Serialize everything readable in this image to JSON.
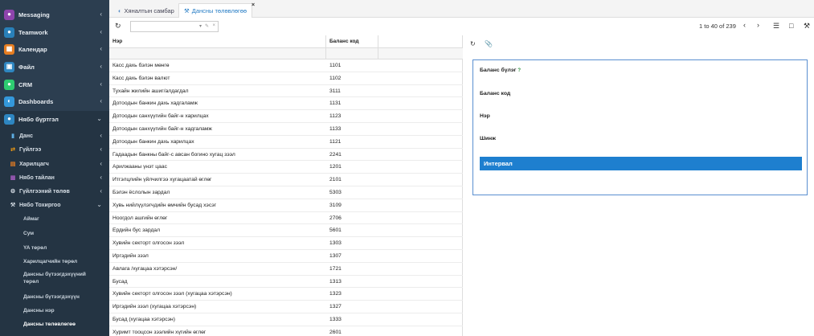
{
  "tabs": [
    {
      "label": "Хяналтын самбар",
      "icon": "dashboard-icon"
    },
    {
      "label": "Дансны төлөвлөгөө",
      "icon": "wrench-icon"
    }
  ],
  "sidebar": {
    "modules": [
      {
        "label": "Messaging",
        "icon": "people-icon",
        "color": "#8e44ad"
      },
      {
        "label": "Teamwork",
        "icon": "user-icon",
        "color": "#2980b9"
      },
      {
        "label": "Календар",
        "icon": "calendar-icon",
        "color": "#e67e22"
      },
      {
        "label": "Файл",
        "icon": "archive-icon",
        "color": "#2e86c1"
      },
      {
        "label": "CRM",
        "icon": "chat-icon",
        "color": "#2ecc71"
      },
      {
        "label": "Dashboards",
        "icon": "dashboard-icon",
        "color": "#3498db"
      },
      {
        "label": "Нябо бүртгэл",
        "icon": "user-icon",
        "color": "#2e86c1"
      }
    ],
    "submenus": [
      {
        "label": "Данс",
        "icon": "book-icon"
      },
      {
        "label": "Гүйлгээ",
        "icon": "exchange-icon"
      },
      {
        "label": "Харилцагч",
        "icon": "card-icon"
      },
      {
        "label": "Нябо тайлан",
        "icon": "bar-chart-icon"
      },
      {
        "label": "Гүйлгээний төлөв",
        "icon": "gears-icon"
      },
      {
        "label": "Нябо Тохиргоо",
        "icon": "wrench-icon"
      }
    ],
    "leaves": [
      "Аймаг",
      "Сум",
      "YA төрөл",
      "Харилцагчийн төрөл",
      "Дансны бүтээгдэхүүний төрөл",
      "Дансны бүтээгдэхүүн",
      "Дансны нэр",
      "Дансны төлөвлөгөө"
    ]
  },
  "filter": {
    "placeholder": ""
  },
  "pager": {
    "text": "1 to 40 of 239"
  },
  "grid": {
    "headers": [
      "Нэр",
      "Баланс код"
    ],
    "rows": [
      {
        "name": "Касс дахь бэлэн мөнгө",
        "code": "1101"
      },
      {
        "name": "Касс дахь бэлэн валют",
        "code": "1102"
      },
      {
        "name": "Тухайн жилийн ашиг/алдагдал",
        "code": "3111"
      },
      {
        "name": "Дотоодын банкин дахь хадгаламж",
        "code": "1131"
      },
      {
        "name": "Дотоодын санхүүгийн байг-н харилцах",
        "code": "1123"
      },
      {
        "name": "Дотоодын санхүүгийн байг-н хадгаламж",
        "code": "1133"
      },
      {
        "name": "Дотоодын банкин дахь харилцах",
        "code": "1121"
      },
      {
        "name": "Гадаадын банкны байг-с авсан богино хугац зээл",
        "code": "2241"
      },
      {
        "name": "Арилжааны үнэт цаас",
        "code": "1201"
      },
      {
        "name": "Итгэлцлийн үйлчилгээ хугацаатай өглөг",
        "code": "2101"
      },
      {
        "name": "Бэлэн ёслолын зардал",
        "code": "5303"
      },
      {
        "name": "Хувь нийлүүлэгчдийн өмчийн бусад хэсэг",
        "code": "3109"
      },
      {
        "name": "Ноогдол ашгийн өглөг",
        "code": "2706"
      },
      {
        "name": "Ердийн бус зардал",
        "code": "5601"
      },
      {
        "name": "Хувийн секторт олгосон зээл",
        "code": "1303"
      },
      {
        "name": "Иргэдийн зээл",
        "code": "1307"
      },
      {
        "name": "Авлага /хугацаа хэтэрсэн/",
        "code": "1721"
      },
      {
        "name": "Бусад",
        "code": "1313"
      },
      {
        "name": "Хувийн секторт олгосон зээл (хугацаа хэтэрсэн)",
        "code": "1323"
      },
      {
        "name": "Иргэдийн зээл (хугацаа хэтэрсэн)",
        "code": "1327"
      },
      {
        "name": "Бусад (хугацаа хэтэрсэн)",
        "code": "1333"
      },
      {
        "name": "Хуримт тооцсон зээлийн хүгийн өглөг",
        "code": "2601"
      }
    ]
  },
  "detail": {
    "fields": [
      "Баланс бүлэг",
      "Баланс код",
      "Нэр",
      "Шинж"
    ],
    "help_mark": "?",
    "section": "Интервал"
  },
  "colors": {
    "accent": "#1e7fcf",
    "sidebar": "#2c3e50"
  }
}
